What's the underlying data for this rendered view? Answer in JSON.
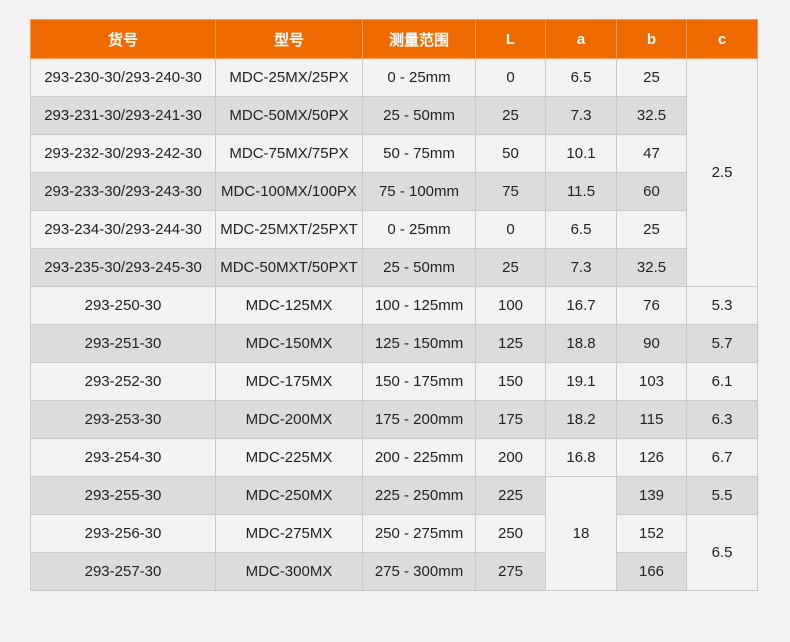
{
  "headers": [
    "货号",
    "型号",
    "测量范围",
    "L",
    "a",
    "b",
    "c"
  ],
  "rows": [
    {
      "item": "293-230-30/293-240-30",
      "model": "MDC-25MX/25PX",
      "range": "0 - 25mm",
      "L": "0",
      "a": "6.5",
      "b": "25"
    },
    {
      "item": "293-231-30/293-241-30",
      "model": "MDC-50MX/50PX",
      "range": "25 - 50mm",
      "L": "25",
      "a": "7.3",
      "b": "32.5"
    },
    {
      "item": "293-232-30/293-242-30",
      "model": "MDC-75MX/75PX",
      "range": "50 - 75mm",
      "L": "50",
      "a": "10.1",
      "b": "47"
    },
    {
      "item": "293-233-30/293-243-30",
      "model": "MDC-100MX/100PX",
      "range": "75 - 100mm",
      "L": "75",
      "a": "11.5",
      "b": "60"
    },
    {
      "item": "293-234-30/293-244-30",
      "model": "MDC-25MXT/25PXT",
      "range": "0 - 25mm",
      "L": "0",
      "a": "6.5",
      "b": "25"
    },
    {
      "item": "293-235-30/293-245-30",
      "model": "MDC-50MXT/50PXT",
      "range": "25 - 50mm",
      "L": "25",
      "a": "7.3",
      "b": "32.5"
    },
    {
      "item": "293-250-30",
      "model": "MDC-125MX",
      "range": "100 - 125mm",
      "L": "100",
      "a": "16.7",
      "b": "76",
      "c": "5.3"
    },
    {
      "item": "293-251-30",
      "model": "MDC-150MX",
      "range": "125 - 150mm",
      "L": "125",
      "a": "18.8",
      "b": "90",
      "c": "5.7"
    },
    {
      "item": "293-252-30",
      "model": "MDC-175MX",
      "range": "150 - 175mm",
      "L": "150",
      "a": "19.1",
      "b": "103",
      "c": "6.1"
    },
    {
      "item": "293-253-30",
      "model": "MDC-200MX",
      "range": "175 - 200mm",
      "L": "175",
      "a": "18.2",
      "b": "115",
      "c": "6.3"
    },
    {
      "item": "293-254-30",
      "model": "MDC-225MX",
      "range": "200 - 225mm",
      "L": "200",
      "a": "16.8",
      "b": "126",
      "c": "6.7"
    },
    {
      "item": "293-255-30",
      "model": "MDC-250MX",
      "range": "225 - 250mm",
      "L": "225",
      "b": "139",
      "c": "5.5"
    },
    {
      "item": "293-256-30",
      "model": "MDC-275MX",
      "range": "250 - 275mm",
      "L": "250",
      "b": "152"
    },
    {
      "item": "293-257-30",
      "model": "MDC-300MX",
      "range": "275 - 300mm",
      "L": "275",
      "b": "166"
    }
  ],
  "merged": {
    "c_rows_1_6": "2.5",
    "a_rows_12_14": "18",
    "c_rows_13_14": "6.5"
  },
  "colors": {
    "header_bg": "#ef6a00",
    "header_text": "#ffffff",
    "row_light": "#f2f2f2",
    "row_dark": "#dcdcdc",
    "border": "#c9c9c9"
  }
}
